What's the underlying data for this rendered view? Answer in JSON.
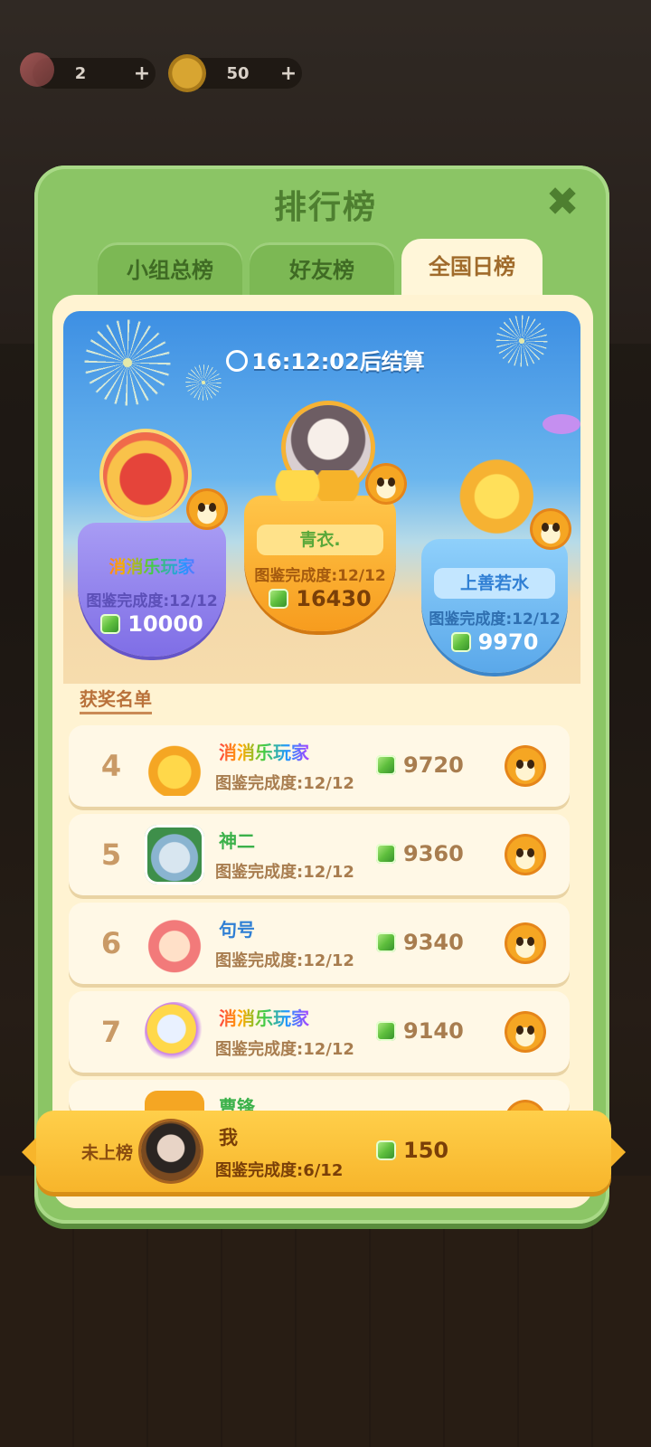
{
  "resources": {
    "tickets": "2",
    "coins": "50",
    "plus": "+"
  },
  "panel": {
    "title": "排行榜",
    "close": "✖"
  },
  "tabs": [
    {
      "label": "小组总榜"
    },
    {
      "label": "好友榜"
    },
    {
      "label": "全国日榜"
    }
  ],
  "timer": "16:12:02后结算",
  "podium": [
    {
      "name": "消消乐玩家",
      "progress": "图鉴完成度:12/12",
      "score": "10000"
    },
    {
      "name": "青衣.",
      "progress": "图鉴完成度:12/12",
      "score": "16430"
    },
    {
      "name": "上善若水",
      "progress": "图鉴完成度:12/12",
      "score": "9970"
    }
  ],
  "section_label": "获奖名单",
  "rows": [
    {
      "rank": "4",
      "name": "消消乐玩家",
      "progress": "图鉴完成度:12/12",
      "score": "9720"
    },
    {
      "rank": "5",
      "name": "神二",
      "progress": "图鉴完成度:12/12",
      "score": "9360"
    },
    {
      "rank": "6",
      "name": "句号",
      "progress": "图鉴完成度:12/12",
      "score": "9340"
    },
    {
      "rank": "7",
      "name": "消消乐玩家",
      "progress": "图鉴完成度:12/12",
      "score": "9140"
    },
    {
      "rank": "",
      "name": "曹锋",
      "progress": "",
      "score": ""
    }
  ],
  "me": {
    "status": "未上榜",
    "name": "我",
    "progress": "图鉴完成度:6/12",
    "score": "150"
  },
  "colors": {
    "panel_green": "#8bc565",
    "active_tab": "#fff6d9",
    "gold_bar": "#f7b52b",
    "rank_text": "#c99a66"
  }
}
